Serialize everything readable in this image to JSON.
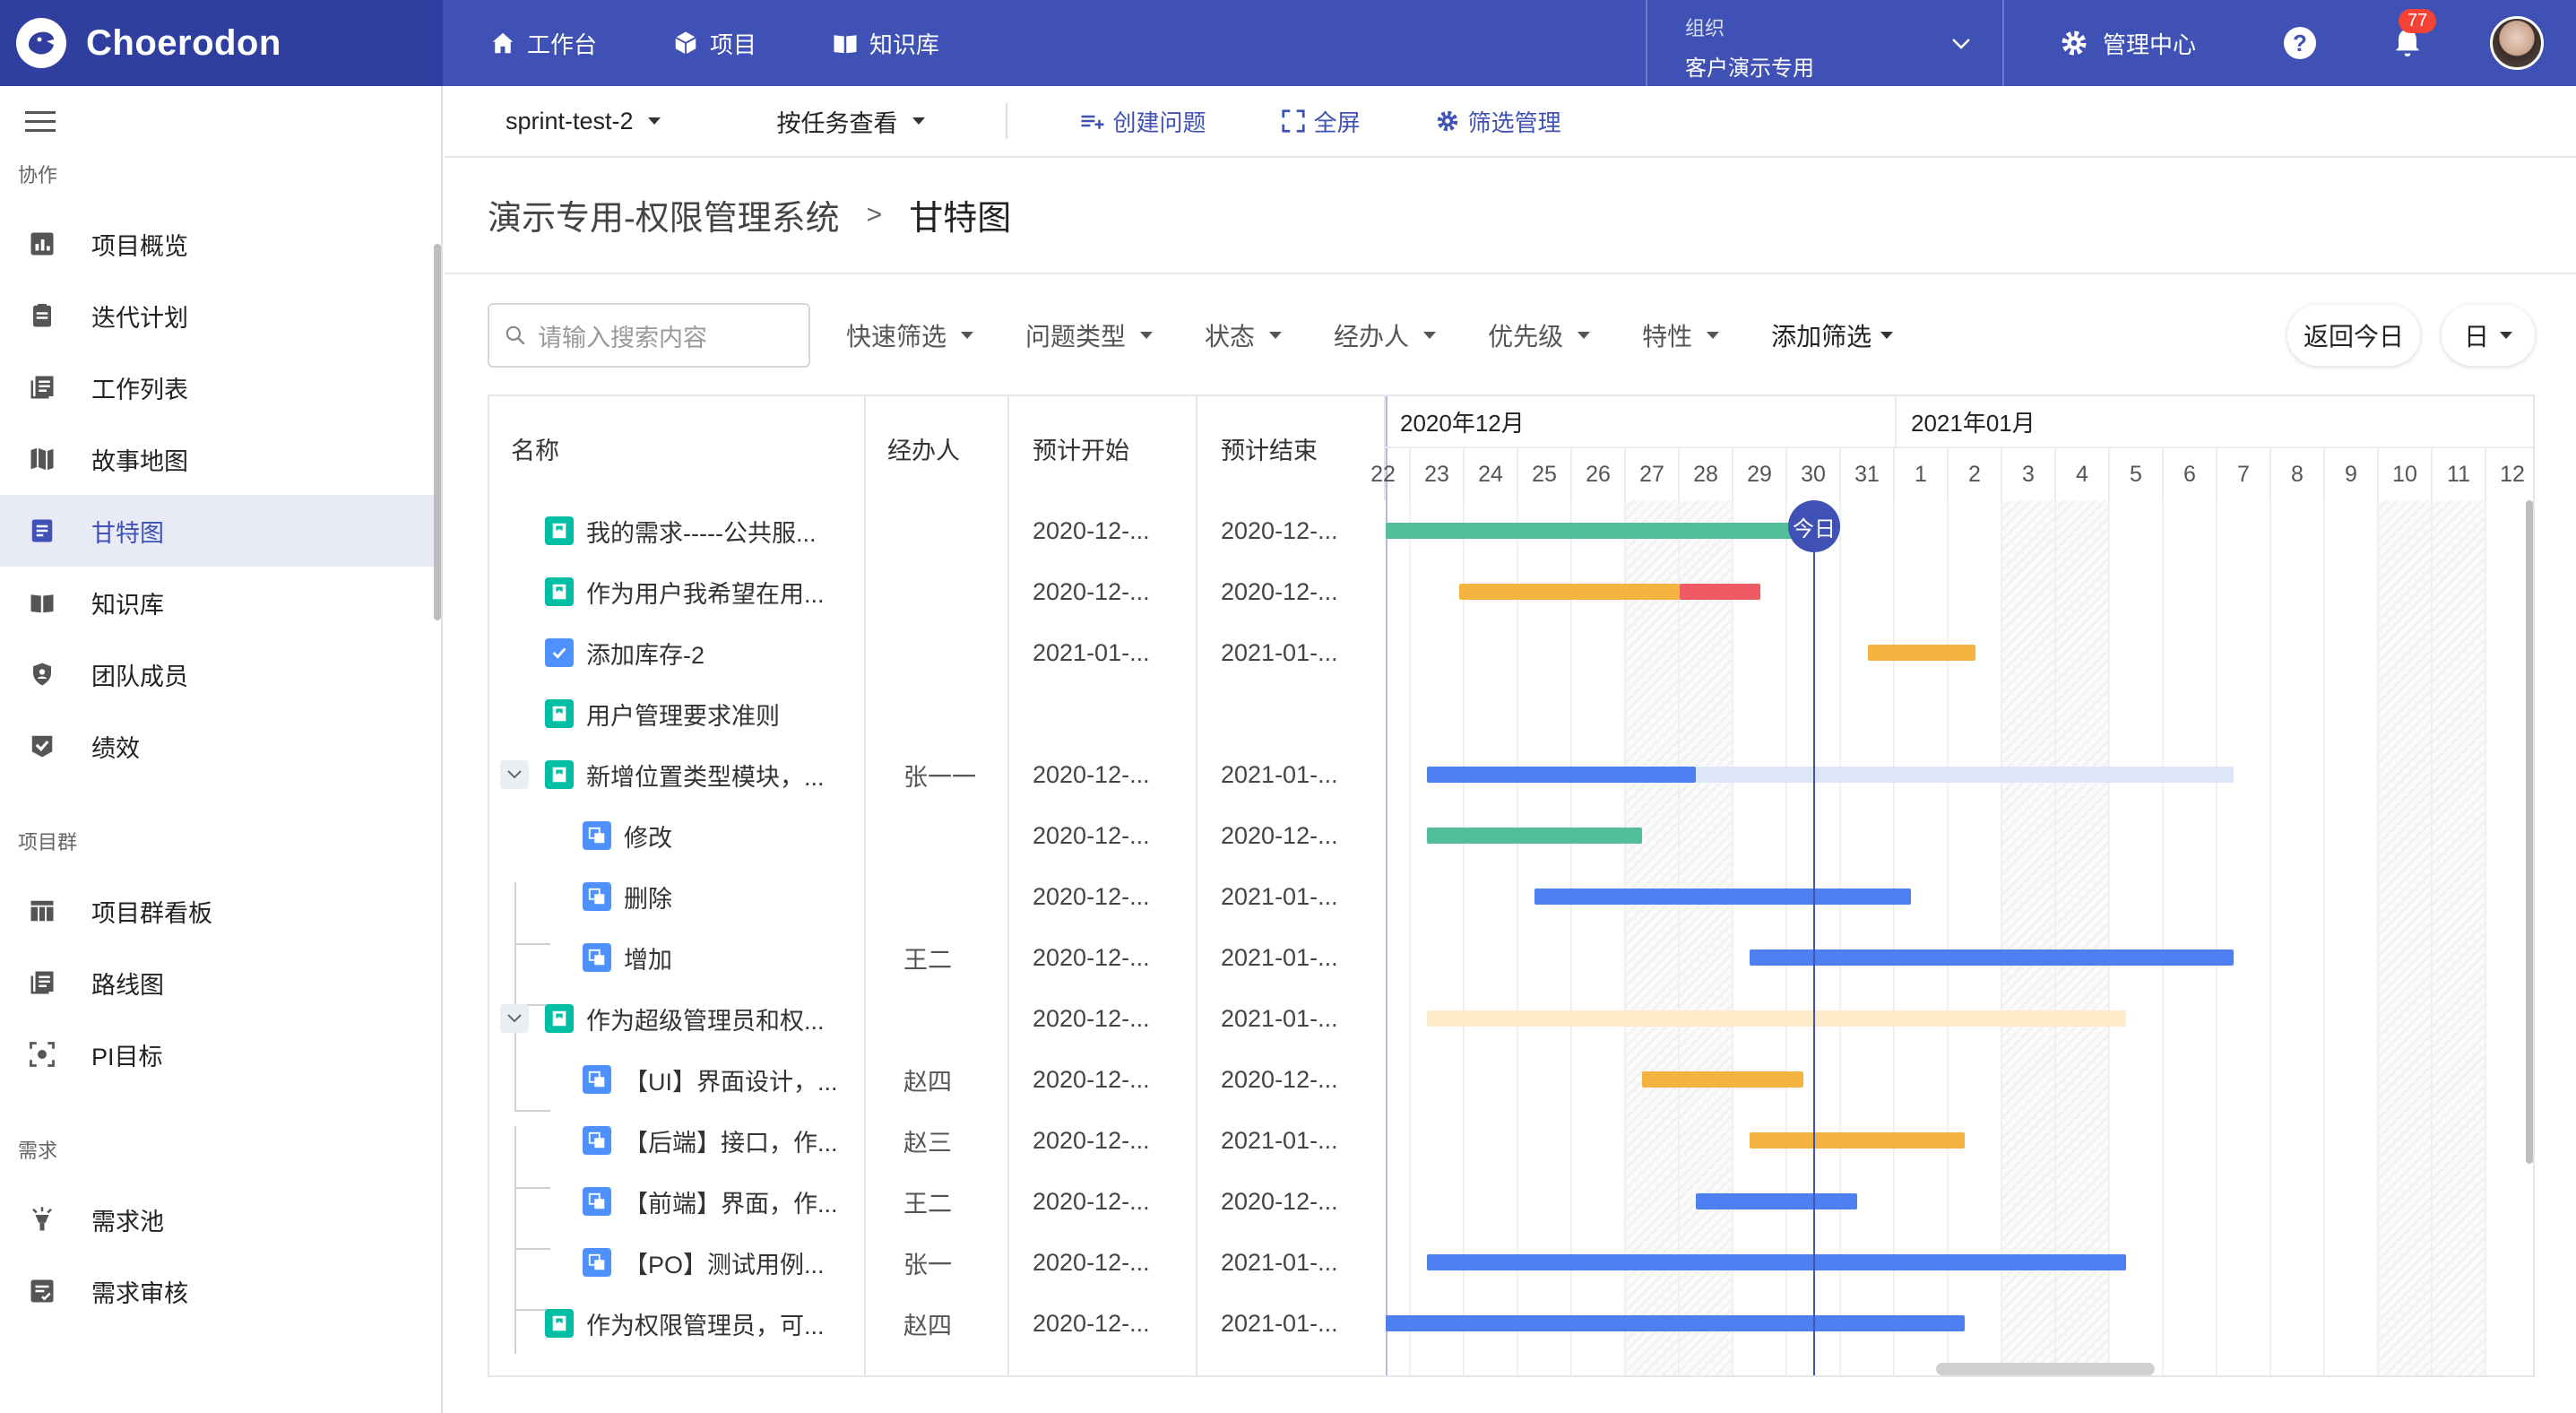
{
  "app": {
    "name": "Choerodon"
  },
  "topnav": [
    {
      "label": "工作台",
      "icon": "home-icon"
    },
    {
      "label": "项目",
      "icon": "cube-icon"
    },
    {
      "label": "知识库",
      "icon": "book-icon"
    }
  ],
  "org": {
    "label": "组织",
    "value": "客户演示专用"
  },
  "admin": {
    "label": "管理中心"
  },
  "notifications": {
    "count": "77"
  },
  "sidebar": {
    "sections": {
      "collab": "协作",
      "group": "项目群",
      "demand": "需求"
    },
    "items": [
      {
        "label": "项目概览",
        "icon": "chart-icon"
      },
      {
        "label": "迭代计划",
        "icon": "clipboard-icon"
      },
      {
        "label": "工作列表",
        "icon": "list-icon"
      },
      {
        "label": "故事地图",
        "icon": "map-icon"
      },
      {
        "label": "甘特图",
        "icon": "gantt-icon"
      },
      {
        "label": "知识库",
        "icon": "book-icon"
      },
      {
        "label": "团队成员",
        "icon": "shield-icon"
      },
      {
        "label": "绩效",
        "icon": "check-badge-icon"
      },
      {
        "label": "项目群看板",
        "icon": "board-icon"
      },
      {
        "label": "路线图",
        "icon": "roadmap-icon"
      },
      {
        "label": "PI目标",
        "icon": "target-icon"
      },
      {
        "label": "需求池",
        "icon": "lamp-icon"
      },
      {
        "label": "需求审核",
        "icon": "review-icon"
      }
    ]
  },
  "toolbar": {
    "sprint": "sprint-test-2",
    "view": "按任务查看",
    "create": "创建问题",
    "fullscreen": "全屏",
    "filter_manage": "筛选管理"
  },
  "breadcrumb": {
    "project": "演示专用-权限管理系统",
    "sep": ">",
    "page": "甘特图"
  },
  "search": {
    "placeholder": "请输入搜索内容"
  },
  "filters": [
    "快速筛选",
    "问题类型",
    "状态",
    "经办人",
    "优先级",
    "特性",
    "添加筛选"
  ],
  "buttons": {
    "today": "返回今日",
    "unit": "日"
  },
  "columns": {
    "name": "名称",
    "assignee": "经办人",
    "start": "预计开始",
    "end": "预计结束"
  },
  "timeline": {
    "months": [
      "2020年12月",
      "2021年01月"
    ],
    "days": [
      "22",
      "23",
      "24",
      "25",
      "26",
      "27",
      "28",
      "29",
      "30",
      "31",
      "1",
      "2",
      "3",
      "4",
      "5",
      "6",
      "7",
      "8",
      "9",
      "10",
      "11",
      "12"
    ],
    "today_label": "今日"
  },
  "rows": [
    {
      "name": "我的需求-----公共服...",
      "assignee": "",
      "start": "2020-12-...",
      "end": "2020-12-...",
      "type": "story"
    },
    {
      "name": "作为用户我希望在用...",
      "assignee": "",
      "start": "2020-12-...",
      "end": "2020-12-...",
      "type": "story"
    },
    {
      "name": "添加库存-2",
      "assignee": "",
      "start": "2021-01-...",
      "end": "2021-01-...",
      "type": "task"
    },
    {
      "name": "用户管理要求准则",
      "assignee": "",
      "start": "",
      "end": "",
      "type": "story"
    },
    {
      "name": "新增位置类型模块，...",
      "assignee": "张一一",
      "start": "2020-12-...",
      "end": "2021-01-...",
      "type": "story"
    },
    {
      "name": "修改",
      "assignee": "",
      "start": "2020-12-...",
      "end": "2020-12-...",
      "type": "sub"
    },
    {
      "name": "删除",
      "assignee": "",
      "start": "2020-12-...",
      "end": "2021-01-...",
      "type": "sub"
    },
    {
      "name": "增加",
      "assignee": "王二",
      "start": "2020-12-...",
      "end": "2021-01-...",
      "type": "sub"
    },
    {
      "name": "作为超级管理员和权...",
      "assignee": "",
      "start": "2020-12-...",
      "end": "2021-01-...",
      "type": "story"
    },
    {
      "name": "【UI】界面设计，...",
      "assignee": "赵四",
      "start": "2020-12-...",
      "end": "2020-12-...",
      "type": "sub"
    },
    {
      "name": "【后端】接口，作...",
      "assignee": "赵三",
      "start": "2020-12-...",
      "end": "2021-01-...",
      "type": "sub"
    },
    {
      "name": "【前端】界面，作...",
      "assignee": "王二",
      "start": "2020-12-...",
      "end": "2020-12-...",
      "type": "sub"
    },
    {
      "name": "【PO】测试用例...",
      "assignee": "张一",
      "start": "2020-12-...",
      "end": "2021-01-...",
      "type": "sub"
    },
    {
      "name": "作为权限管理员，可...",
      "assignee": "赵四",
      "start": "2020-12-...",
      "end": "2021-01-...",
      "type": "story"
    }
  ],
  "colors": {
    "primary": "#3f51b5",
    "brand_dark": "#303f9f",
    "green": "#52bf9b",
    "orange": "#f5b340",
    "red": "#ef5a64",
    "blue": "#4d7ff0",
    "light_blue": "#dde6f8",
    "light_orange": "#fdebc8"
  }
}
